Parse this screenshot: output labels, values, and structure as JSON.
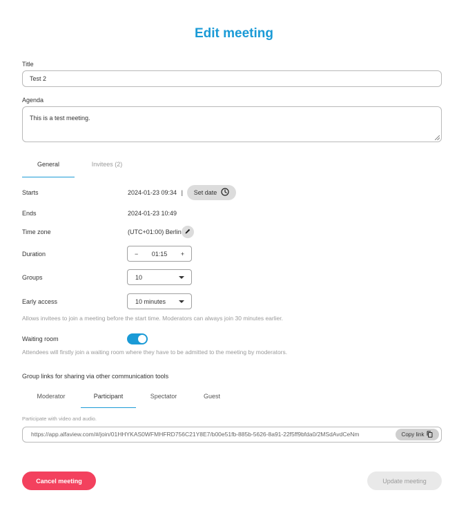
{
  "page": {
    "title": "Edit meeting"
  },
  "form": {
    "title_label": "Title",
    "title_value": "Test 2",
    "agenda_label": "Agenda",
    "agenda_value": "This is a test meeting."
  },
  "tabs": [
    {
      "label": "General",
      "active": true
    },
    {
      "label": "Invitees (2)",
      "active": false
    }
  ],
  "general": {
    "starts_label": "Starts",
    "starts_value": "2024-01-23 09:34",
    "separator": "|",
    "set_date_label": "Set date",
    "ends_label": "Ends",
    "ends_value": "2024-01-23 10:49",
    "timezone_label": "Time zone",
    "timezone_value": "(UTC+01:00) Berlin",
    "duration_label": "Duration",
    "duration_value": "01:15",
    "duration_minus": "−",
    "duration_plus": "+",
    "groups_label": "Groups",
    "groups_value": "10",
    "early_access_label": "Early access",
    "early_access_value": "10 minutes",
    "early_access_hint": "Allows invitees to join a meeting before the start time. Moderators can always join 30 minutes earlier.",
    "waiting_room_label": "Waiting room",
    "waiting_room_enabled": true,
    "waiting_room_hint": "Attendees will firstly join a waiting room where they have to be admitted to the meeting by moderators."
  },
  "group_links": {
    "title": "Group links for sharing via other communication tools",
    "tabs": [
      {
        "label": "Moderator",
        "active": false
      },
      {
        "label": "Participant",
        "active": true
      },
      {
        "label": "Spectator",
        "active": false
      },
      {
        "label": "Guest",
        "active": false
      }
    ],
    "description": "Participate with video and audio.",
    "link": "https://app.alfaview.com/#/join/01HHYKAS0WFMHFRD756C21Y8E7/b00e51fb-885b-5626-8a91-22f5ff9bfda0/2MSdAvdCeNm",
    "copy_label": "Copy link"
  },
  "actions": {
    "cancel_label": "Cancel meeting",
    "update_label": "Update meeting"
  },
  "colors": {
    "accent": "#1a9ad6",
    "danger": "#f3415e",
    "disabled_bg": "#e9e9e9"
  }
}
